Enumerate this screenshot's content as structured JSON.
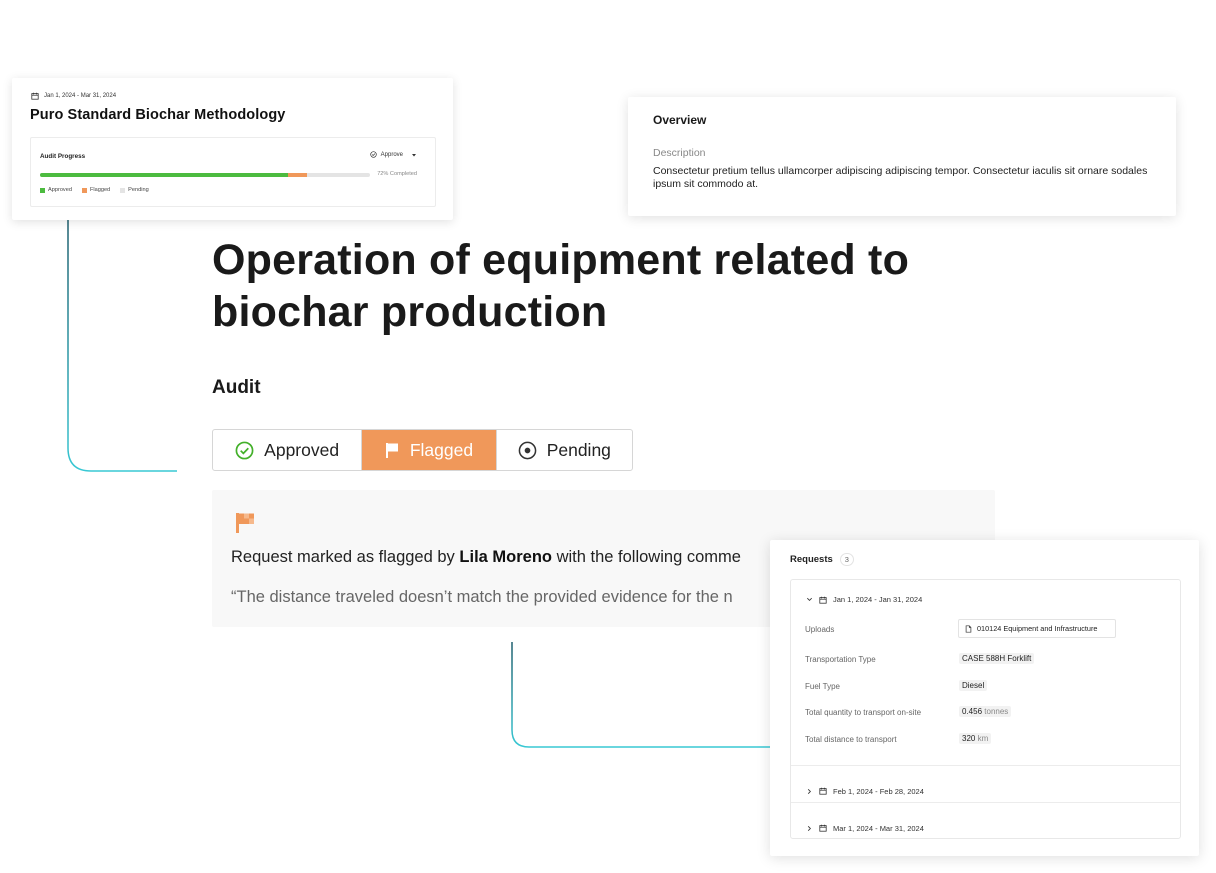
{
  "methodology_card": {
    "date_range": "Jan 1, 2024 - Mar 31, 2024",
    "title": "Puro Standard Biochar Methodology",
    "audit_progress": {
      "title": "Audit Progress",
      "action_label": "Approve",
      "completed_label": "72% Completed",
      "approved_fraction": 0.75,
      "flagged_fraction": 0.06,
      "legend": {
        "approved": "Approved",
        "flagged": "Flagged",
        "pending": "Pending"
      }
    }
  },
  "overview": {
    "title": "Overview",
    "description_label": "Description",
    "description": "Consectetur pretium tellus ullamcorper adipiscing adipiscing tempor. Consectetur iaculis sit ornare sodales ipsum sit commodo at."
  },
  "main": {
    "title": "Operation of equipment related to biochar production",
    "audit_heading": "Audit",
    "status_options": [
      {
        "label": "Approved",
        "selected": false
      },
      {
        "label": "Flagged",
        "selected": true
      },
      {
        "label": "Pending",
        "selected": false
      }
    ],
    "flag_message_prefix": "Request marked as flagged by",
    "flag_user": "Lila Moreno",
    "flag_message_suffix": "with the following comme",
    "flag_comment": "“The distance traveled doesn’t match the provided evidence for the n"
  },
  "requests": {
    "title": "Requests",
    "count": "3",
    "groups": [
      {
        "date_range": "Jan 1, 2024 - Jan 31, 2024",
        "expanded": true,
        "fields": {
          "uploads_label": "Uploads",
          "upload_file": "010124 Equipment and Infrastructure",
          "transport_type_label": "Transportation Type",
          "transport_type": "CASE 588H Forklift",
          "fuel_type_label": "Fuel Type",
          "fuel_type": "Diesel",
          "quantity_label": "Total quantity to transport on-site",
          "quantity_value": "0.456",
          "quantity_unit": "tonnes",
          "distance_label": "Total distance to transport",
          "distance_value": "320",
          "distance_unit": "km"
        }
      },
      {
        "date_range": "Feb 1, 2024 - Feb 28, 2024",
        "expanded": false
      },
      {
        "date_range": "Mar 1, 2024 - Mar 31, 2024",
        "expanded": false
      }
    ]
  },
  "colors": {
    "approved": "#4cbb3f",
    "flagged": "#f0985a",
    "pending": "#e4e4e4",
    "connector": "#3cc4d0"
  }
}
